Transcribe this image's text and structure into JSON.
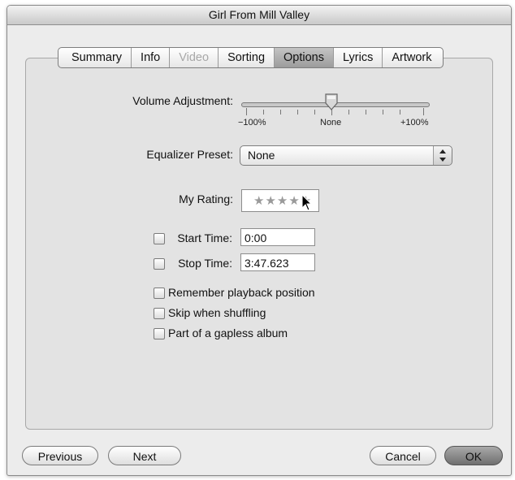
{
  "window": {
    "title": "Girl From Mill Valley"
  },
  "tabs": [
    {
      "label": "Summary",
      "state": "normal"
    },
    {
      "label": "Info",
      "state": "normal"
    },
    {
      "label": "Video",
      "state": "disabled"
    },
    {
      "label": "Sorting",
      "state": "normal"
    },
    {
      "label": "Options",
      "state": "selected"
    },
    {
      "label": "Lyrics",
      "state": "normal"
    },
    {
      "label": "Artwork",
      "state": "normal"
    }
  ],
  "options": {
    "volume": {
      "label": "Volume Adjustment:",
      "min_label": "−100%",
      "mid_label": "None",
      "max_label": "+100%",
      "value_percent": 0
    },
    "equalizer": {
      "label": "Equalizer Preset:",
      "value": "None"
    },
    "rating": {
      "label": "My Rating:",
      "stars": "★★★★★",
      "value": 0
    },
    "start_time": {
      "label": "Start Time:",
      "value": "0:00",
      "checked": false
    },
    "stop_time": {
      "label": "Stop Time:",
      "value": "3:47.623",
      "checked": false
    },
    "remember_playback": {
      "label": "Remember playback position",
      "checked": false
    },
    "skip_shuffling": {
      "label": "Skip when shuffling",
      "checked": false
    },
    "gapless_album": {
      "label": "Part of a gapless album",
      "checked": false
    }
  },
  "footer": {
    "previous": "Previous",
    "next": "Next",
    "cancel": "Cancel",
    "ok": "OK"
  },
  "icons": {
    "slider_thumb": "slider-thumb-icon",
    "popup_arrows": "updown-arrows-icon",
    "cursor": "pointer-cursor-icon"
  }
}
